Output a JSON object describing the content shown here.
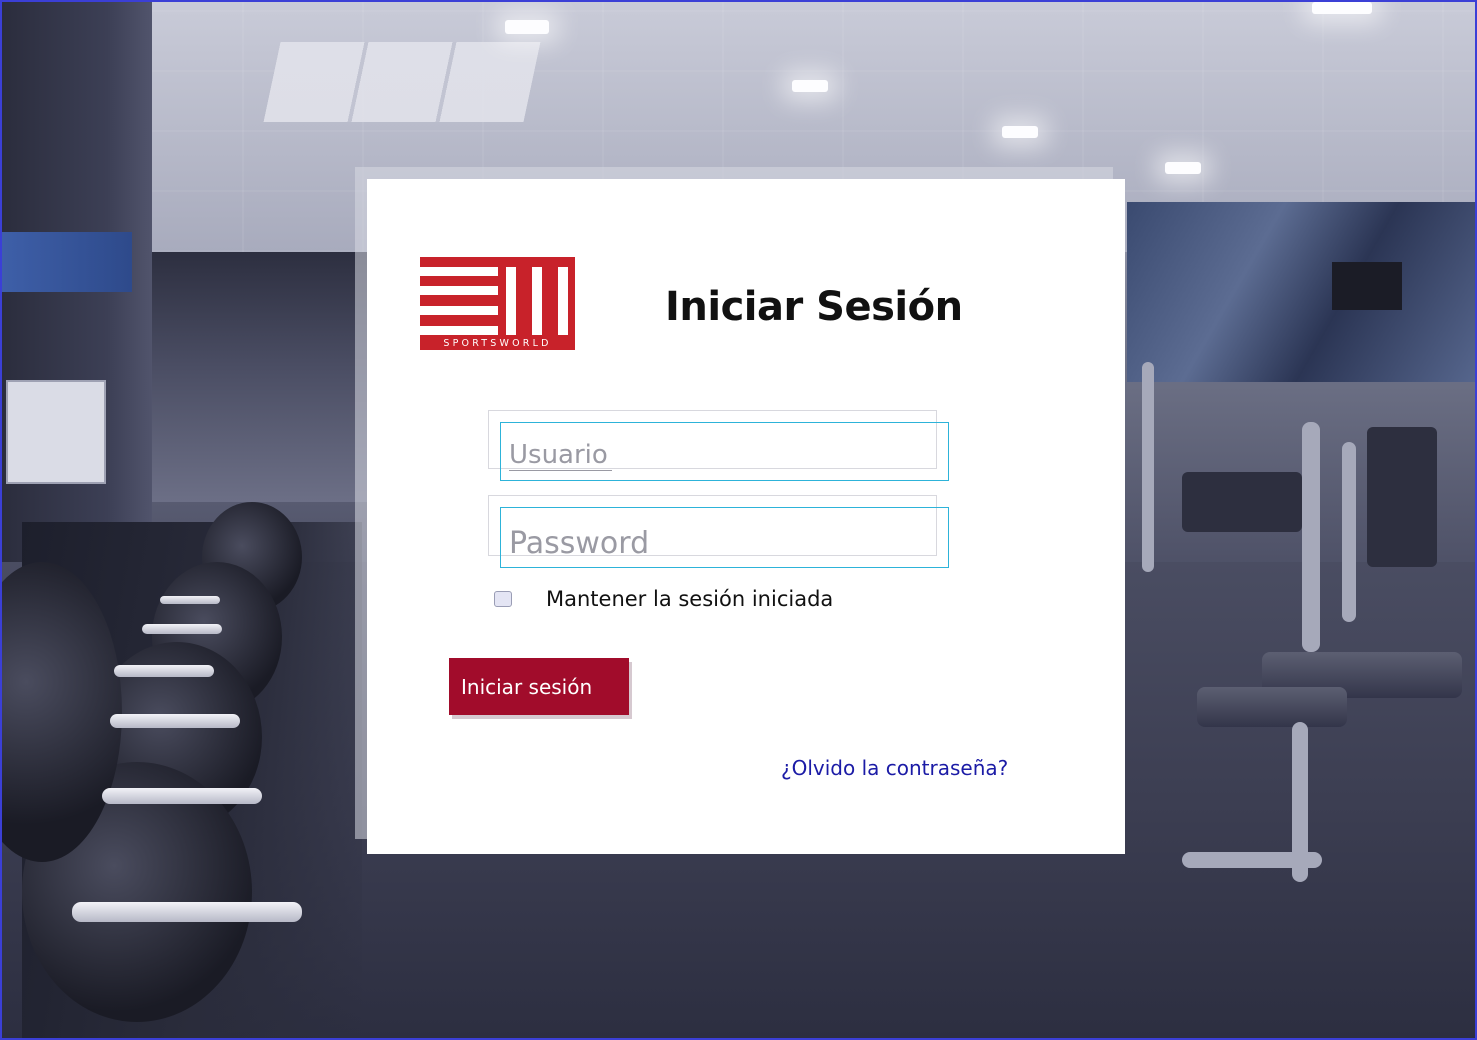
{
  "login": {
    "title": "Iniciar Sesión",
    "logo_text": "SPORTSWORLD",
    "username_placeholder": "Usuario",
    "password_placeholder": "Password",
    "remember_label": "Mantener la sesión iniciada",
    "remember_checked": false,
    "submit_label": "Iniciar sesión",
    "forgot_label": "¿Olvido la contraseña?"
  },
  "colors": {
    "brand_red": "#c8222a",
    "button_red": "#a10c2b",
    "link_blue": "#1b1ba6",
    "field_border": "#2db3d9",
    "frame_border": "#3b3fd6"
  },
  "background": {
    "subject": "gym-interior-photo"
  }
}
